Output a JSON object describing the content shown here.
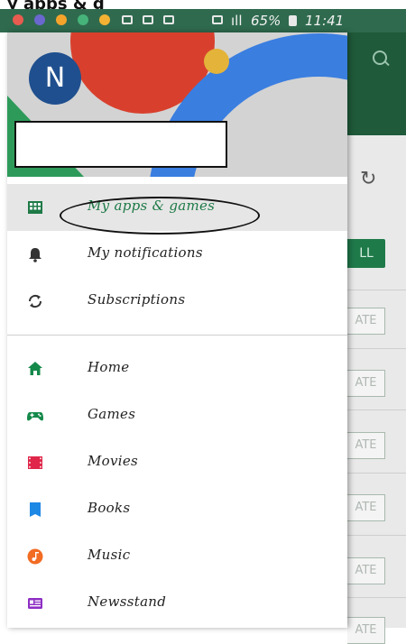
{
  "top_partial_text": "y apps & g",
  "status_bar": {
    "text": "65%",
    "time": "11:41",
    "signal": "ıll"
  },
  "profile": {
    "initial": "N"
  },
  "menu": {
    "items": [
      {
        "label": "My apps & games",
        "icon": "apps-icon",
        "color": "#1e7a47"
      },
      {
        "label": "My notifications",
        "icon": "bell-icon",
        "color": "#333333"
      },
      {
        "label": "Subscriptions",
        "icon": "refresh-icon",
        "color": "#333333"
      },
      {
        "label": "Home",
        "icon": "home-icon",
        "color": "#14894a"
      },
      {
        "label": "Games",
        "icon": "gamepad-icon",
        "color": "#14894a"
      },
      {
        "label": "Movies",
        "icon": "film-icon",
        "color": "#e0264a"
      },
      {
        "label": "Books",
        "icon": "book-icon",
        "color": "#1e88e5"
      },
      {
        "label": "Music",
        "icon": "music-icon",
        "color": "#f26c23"
      },
      {
        "label": "Newsstand",
        "icon": "newsstand-icon",
        "color": "#8e2ec4"
      }
    ]
  },
  "background_list": {
    "all_label": "LL",
    "update_labels": [
      "ATE",
      "ATE",
      "ATE",
      "ATE",
      "ATE",
      "ATE"
    ]
  }
}
